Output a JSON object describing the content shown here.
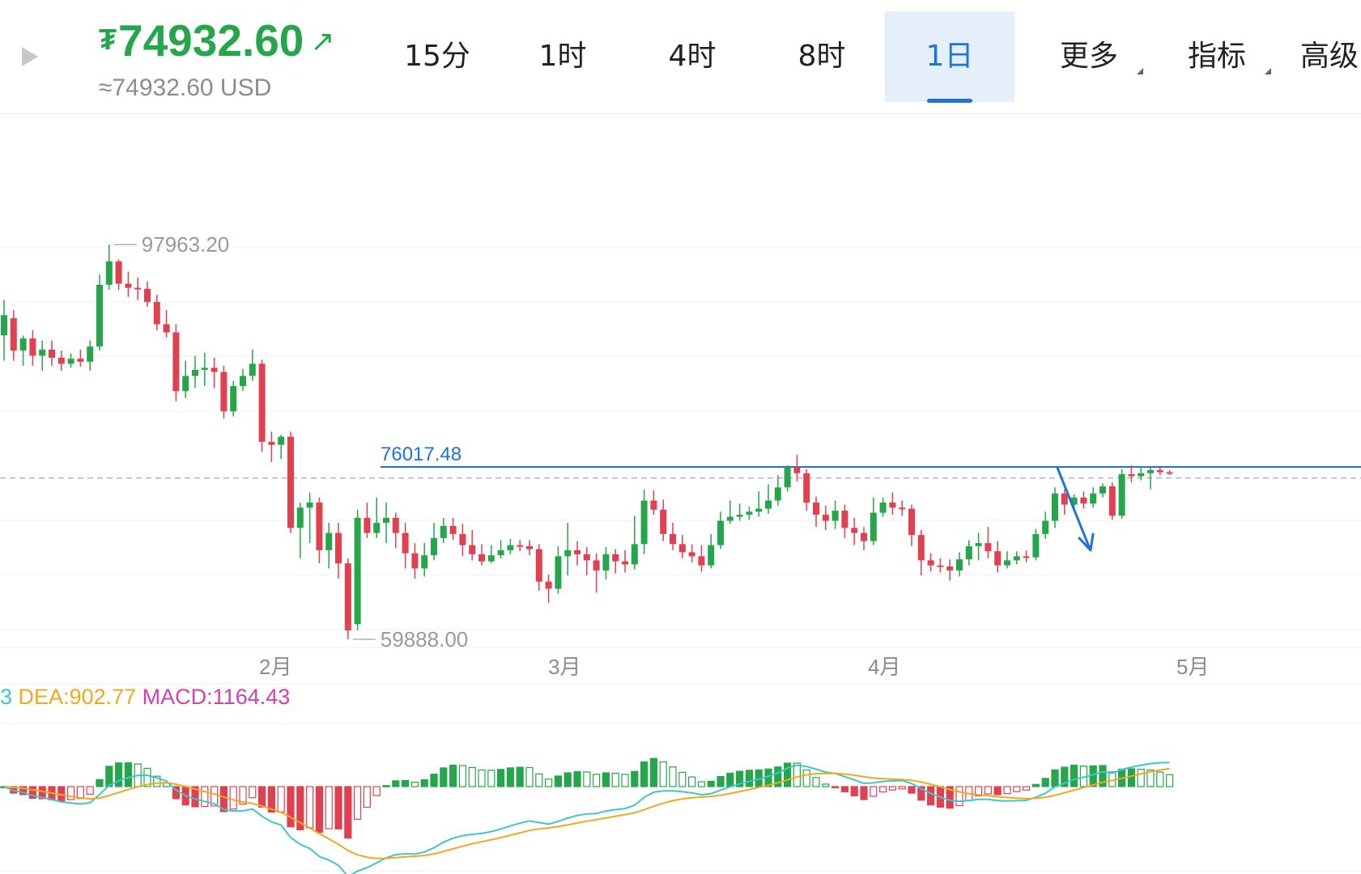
{
  "header": {
    "currency_symbol": "₮",
    "price": "74932.60",
    "price_arrow": "↗",
    "usd_value": "≈74932.60 USD"
  },
  "tabs": [
    {
      "label": "15分",
      "active": false
    },
    {
      "label": "1时",
      "active": false
    },
    {
      "label": "4时",
      "active": false
    },
    {
      "label": "8时",
      "active": false
    },
    {
      "label": "1日",
      "active": true
    },
    {
      "label": "更多",
      "dropdown": true
    },
    {
      "label": "指标",
      "dropdown": true
    },
    {
      "label": "高级"
    }
  ],
  "colors": {
    "up": "#26a64a",
    "down": "#e0404f",
    "accent": "#1e72d8",
    "dif": "#3fc6c6",
    "dea": "#f0a81c",
    "macd": "#d33fb0"
  },
  "chart_data": {
    "type": "candlestick",
    "ylim": [
      56000,
      104000
    ],
    "high_label": "97963.20",
    "low_label": "59888.00",
    "level_label": "76017.48",
    "level_value": 76017.48,
    "current_price": 74932.6,
    "month_labels": [
      "2月",
      "3月",
      "4月",
      "5月"
    ],
    "candles": [
      [
        89000,
        91000,
        86500,
        92500
      ],
      [
        90700,
        87500,
        86500,
        91500
      ],
      [
        87500,
        88700,
        86000,
        89000
      ],
      [
        88700,
        87000,
        86000,
        89500
      ],
      [
        87000,
        87600,
        85500,
        88500
      ],
      [
        87600,
        86800,
        86000,
        88500
      ],
      [
        86800,
        86200,
        85500,
        87500
      ],
      [
        86200,
        86700,
        85800,
        87200
      ],
      [
        86700,
        86400,
        85900,
        87600
      ],
      [
        86400,
        87900,
        85500,
        88500
      ],
      [
        87900,
        94000,
        87500,
        95000
      ],
      [
        94000,
        96300,
        93500,
        97963
      ],
      [
        96300,
        94100,
        93500,
        96500
      ],
      [
        94100,
        93700,
        92800,
        95300
      ],
      [
        93700,
        93600,
        92500,
        94700
      ],
      [
        93600,
        92300,
        91800,
        94300
      ],
      [
        92300,
        90100,
        89500,
        93000
      ],
      [
        90100,
        89300,
        88800,
        91500
      ],
      [
        89300,
        83500,
        82500,
        90100
      ],
      [
        83500,
        85000,
        82800,
        86500
      ],
      [
        85000,
        85600,
        83800,
        87000
      ],
      [
        85600,
        85800,
        84000,
        87300
      ],
      [
        85800,
        85400,
        83800,
        86800
      ],
      [
        85400,
        81500,
        80800,
        86000
      ],
      [
        81500,
        84000,
        81000,
        84500
      ],
      [
        84000,
        85000,
        83500,
        85700
      ],
      [
        85000,
        86200,
        84500,
        87600
      ],
      [
        86200,
        78500,
        77500,
        86600
      ],
      [
        78500,
        78200,
        76500,
        79500
      ],
      [
        78200,
        79000,
        76800,
        79200
      ],
      [
        79000,
        70000,
        69500,
        79500
      ],
      [
        70000,
        72000,
        67000,
        72500
      ],
      [
        72000,
        72500,
        68500,
        73500
      ],
      [
        72500,
        67800,
        66500,
        73000
      ],
      [
        67800,
        69500,
        66000,
        70500
      ],
      [
        69500,
        66500,
        65000,
        70500
      ],
      [
        66500,
        59888,
        59000,
        67000
      ],
      [
        60500,
        71000,
        59888,
        71800
      ],
      [
        71000,
        69500,
        69000,
        72500
      ],
      [
        69500,
        70500,
        69000,
        73000
      ],
      [
        70500,
        71000,
        68500,
        72500
      ],
      [
        71000,
        69500,
        68000,
        71500
      ],
      [
        69500,
        67500,
        66000,
        70500
      ],
      [
        67500,
        66000,
        65000,
        68500
      ],
      [
        66000,
        67300,
        65200,
        68500
      ],
      [
        67300,
        69000,
        66800,
        70500
      ],
      [
        69000,
        70200,
        68500,
        71000
      ],
      [
        70200,
        69400,
        68800,
        71000
      ],
      [
        69400,
        68300,
        67200,
        70400
      ],
      [
        68300,
        67400,
        66800,
        69800
      ],
      [
        67400,
        66700,
        66300,
        68400
      ],
      [
        66700,
        67300,
        66500,
        68300
      ],
      [
        67300,
        67800,
        67000,
        68800
      ],
      [
        67800,
        68300,
        67400,
        68900
      ],
      [
        68300,
        68200,
        67700,
        68800
      ],
      [
        68200,
        67900,
        67300,
        68800
      ],
      [
        67900,
        64700,
        63800,
        68400
      ],
      [
        64700,
        64000,
        62600,
        65400
      ],
      [
        64000,
        67200,
        63500,
        68200
      ],
      [
        67200,
        67800,
        65300,
        70500
      ],
      [
        67800,
        67400,
        66300,
        68700
      ],
      [
        67400,
        66800,
        65300,
        68100
      ],
      [
        66800,
        65800,
        63600,
        67500
      ],
      [
        65800,
        67400,
        64900,
        68100
      ],
      [
        67400,
        66700,
        65500,
        67900
      ],
      [
        66700,
        66400,
        65600,
        67800
      ],
      [
        66400,
        68400,
        65900,
        71200
      ],
      [
        68400,
        72700,
        67400,
        73800
      ],
      [
        72700,
        71800,
        71300,
        73700
      ],
      [
        71800,
        69400,
        68700,
        72800
      ],
      [
        69400,
        68400,
        67800,
        70500
      ],
      [
        68400,
        67600,
        67000,
        69300
      ],
      [
        67600,
        67200,
        66600,
        68400
      ],
      [
        67200,
        66300,
        65700,
        68300
      ],
      [
        66300,
        68300,
        66000,
        69400
      ],
      [
        68300,
        70700,
        67900,
        71600
      ],
      [
        70700,
        71100,
        70400,
        72700
      ],
      [
        71100,
        71300,
        70700,
        72400
      ],
      [
        71300,
        71600,
        70800,
        72100
      ],
      [
        71600,
        71900,
        71100,
        73600
      ],
      [
        71900,
        72700,
        71400,
        74300
      ],
      [
        72700,
        74000,
        72200,
        75200
      ],
      [
        74000,
        76000,
        73600,
        76200
      ],
      [
        76000,
        75400,
        74600,
        77200
      ],
      [
        75400,
        72500,
        71700,
        75800
      ],
      [
        72500,
        71300,
        70100,
        73100
      ],
      [
        71300,
        70700,
        69800,
        72200
      ],
      [
        70700,
        71700,
        69900,
        72700
      ],
      [
        71700,
        70000,
        69000,
        72300
      ],
      [
        70000,
        69500,
        68300,
        71000
      ],
      [
        69500,
        68700,
        67800,
        70100
      ],
      [
        68700,
        71500,
        68300,
        73000
      ],
      [
        71500,
        72500,
        71100,
        73000
      ],
      [
        72500,
        72000,
        71300,
        73500
      ],
      [
        72000,
        71900,
        71200,
        72700
      ],
      [
        71900,
        69300,
        68200,
        72300
      ],
      [
        69300,
        66800,
        65300,
        69800
      ],
      [
        66800,
        66300,
        65700,
        67500
      ],
      [
        66300,
        66200,
        65600,
        67000
      ],
      [
        66200,
        65800,
        64800,
        66900
      ],
      [
        65800,
        66900,
        65200,
        67600
      ],
      [
        66900,
        68200,
        66300,
        68800
      ],
      [
        68200,
        68500,
        66800,
        69500
      ],
      [
        68500,
        67700,
        67000,
        70100
      ],
      [
        67700,
        66300,
        65600,
        68700
      ],
      [
        66300,
        66800,
        66000,
        67700
      ],
      [
        66800,
        67200,
        66400,
        67700
      ],
      [
        67200,
        67100,
        66600,
        67800
      ],
      [
        67100,
        69400,
        66800,
        69900
      ],
      [
        69400,
        70700,
        68900,
        71600
      ],
      [
        70700,
        73400,
        70000,
        74000
      ],
      [
        73400,
        72300,
        71300,
        73800
      ],
      [
        72300,
        73000,
        71600,
        73300
      ],
      [
        73000,
        72400,
        71900,
        73600
      ],
      [
        72400,
        73400,
        72000,
        74000
      ],
      [
        73400,
        74100,
        73000,
        74400
      ],
      [
        74100,
        71200,
        70800,
        74500
      ],
      [
        71200,
        75300,
        70900,
        75800
      ],
      [
        75300,
        75100,
        74500,
        76200
      ],
      [
        75100,
        75400,
        74700,
        76000
      ],
      [
        75400,
        75700,
        73800,
        76000
      ],
      [
        75700,
        75500,
        75200,
        76000
      ],
      [
        75500,
        75400,
        75200,
        75700
      ]
    ],
    "macd_legend": {
      "dif": "3",
      "dea": "DEA:902.77",
      "macd": "MACD:1164.43"
    }
  }
}
